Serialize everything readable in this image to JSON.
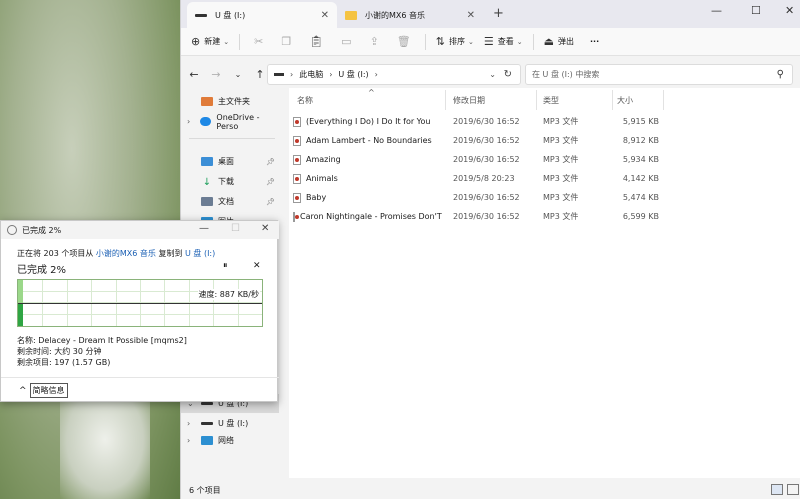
{
  "tabs": [
    {
      "label": "U 盘 (I:)",
      "active": true
    },
    {
      "label": "小谢的MX6 音乐",
      "active": false
    }
  ],
  "window_controls": {
    "minimize": "—",
    "maximize": "☐",
    "close": "✕"
  },
  "toolbar": {
    "new_label": "新建",
    "sort_label": "排序",
    "view_label": "查看",
    "eject_label": "弹出",
    "more_label": "···"
  },
  "address": {
    "root_label": "此电脑",
    "drive_label": "U 盘 (I:)",
    "search_placeholder": "在 U 盘 (I:) 中搜索"
  },
  "nav": {
    "home": "主文件夹",
    "onedrive": "OneDrive - Perso",
    "desktop": "桌面",
    "downloads": "下载",
    "documents": "文档",
    "pictures": "图片",
    "drive": "U 盘 (I:)",
    "drive2": "U 盘 (I:)",
    "network": "网络"
  },
  "columns": {
    "name": "名称",
    "modified": "修改日期",
    "type": "类型",
    "size": "大小"
  },
  "files": [
    {
      "name": "(Everything I Do) I Do It for You",
      "modified": "2019/6/30 16:52",
      "type": "MP3 文件",
      "size": "5,915 KB"
    },
    {
      "name": "Adam Lambert - No Boundaries",
      "modified": "2019/6/30 16:52",
      "type": "MP3 文件",
      "size": "8,912 KB"
    },
    {
      "name": "Amazing",
      "modified": "2019/6/30 16:52",
      "type": "MP3 文件",
      "size": "5,934 KB"
    },
    {
      "name": "Animals",
      "modified": "2019/5/8 20:23",
      "type": "MP3 文件",
      "size": "4,142 KB"
    },
    {
      "name": "Baby",
      "modified": "2019/6/30 16:52",
      "type": "MP3 文件",
      "size": "5,474 KB"
    },
    {
      "name": "Caron Nightingale - Promises Don'T ...",
      "modified": "2019/6/30 16:52",
      "type": "MP3 文件",
      "size": "6,599 KB"
    }
  ],
  "status": {
    "item_count": "6 个项目"
  },
  "dialog": {
    "title": "已完成 2%",
    "line1_prefix": "正在将 203 个项目从",
    "source": "小谢的MX6 音乐",
    "line1_mid": "复制到",
    "dest": "U 盘 (I:)",
    "heading": "已完成 2%",
    "pause_icon_text": "⏸",
    "cancel_icon_text": "✕",
    "speed": "速度: 887 KB/秒",
    "progress_percent": 2,
    "name_line": "名称: Delacey - Dream It Possible [mqms2]",
    "time_line": "剩余时间: 大约 30 分钟",
    "items_line": "剩余项目: 197 (1.57 GB)",
    "less_details": "简略信息"
  },
  "colors": {
    "accent": "#1a5fb4",
    "progress": "#2fa543",
    "folder": "#f5c342"
  }
}
